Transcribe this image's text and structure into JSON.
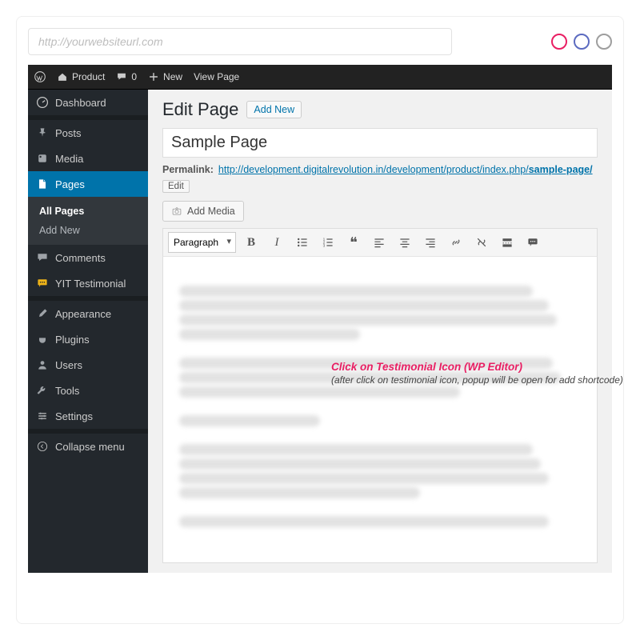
{
  "browser": {
    "url_placeholder": "http://yourwebsiteurl.com"
  },
  "admin_bar": {
    "site_name": "Product",
    "comments_count": "0",
    "new_label": "New",
    "view_page": "View Page"
  },
  "sidebar": {
    "items": [
      {
        "label": "Dashboard",
        "icon": "gauge"
      },
      {
        "label": "Posts",
        "icon": "pin"
      },
      {
        "label": "Media",
        "icon": "media"
      },
      {
        "label": "Pages",
        "icon": "page",
        "active": true
      },
      {
        "label": "Comments",
        "icon": "comment"
      },
      {
        "label": "YIT Testimonial",
        "icon": "chat-yellow"
      },
      {
        "label": "Appearance",
        "icon": "brush"
      },
      {
        "label": "Plugins",
        "icon": "plug"
      },
      {
        "label": "Users",
        "icon": "user"
      },
      {
        "label": "Tools",
        "icon": "wrench"
      },
      {
        "label": "Settings",
        "icon": "sliders"
      }
    ],
    "pages_sub": [
      {
        "label": "All Pages",
        "active": true
      },
      {
        "label": "Add New",
        "active": false
      }
    ],
    "collapse": "Collapse menu"
  },
  "main": {
    "heading": "Edit Page",
    "add_new": "Add New",
    "title_value": "Sample Page",
    "permalink_label": "Permalink:",
    "permalink_base": "http://development.digitalrevolution.in/development/product/index.php/",
    "permalink_slug": "sample-page/",
    "edit_label": "Edit",
    "add_media": "Add Media"
  },
  "toolbar": {
    "format_value": "Paragraph",
    "buttons": [
      {
        "name": "bold",
        "glyph": "B"
      },
      {
        "name": "italic",
        "glyph": "I"
      },
      {
        "name": "bullet-list",
        "glyph": "ul"
      },
      {
        "name": "number-list",
        "glyph": "ol"
      },
      {
        "name": "blockquote",
        "glyph": "❝"
      },
      {
        "name": "align-left",
        "glyph": "al"
      },
      {
        "name": "align-center",
        "glyph": "ac"
      },
      {
        "name": "align-right",
        "glyph": "ar"
      },
      {
        "name": "link",
        "glyph": "link"
      },
      {
        "name": "unlink",
        "glyph": "unlink"
      },
      {
        "name": "read-more",
        "glyph": "more"
      },
      {
        "name": "testimonial",
        "glyph": "testimonial"
      }
    ]
  },
  "annotation": {
    "line1": "Click on Testimonial Icon (WP Editor)",
    "line2": "(after click on testimonial icon, popup will be open for add shortcode)"
  }
}
